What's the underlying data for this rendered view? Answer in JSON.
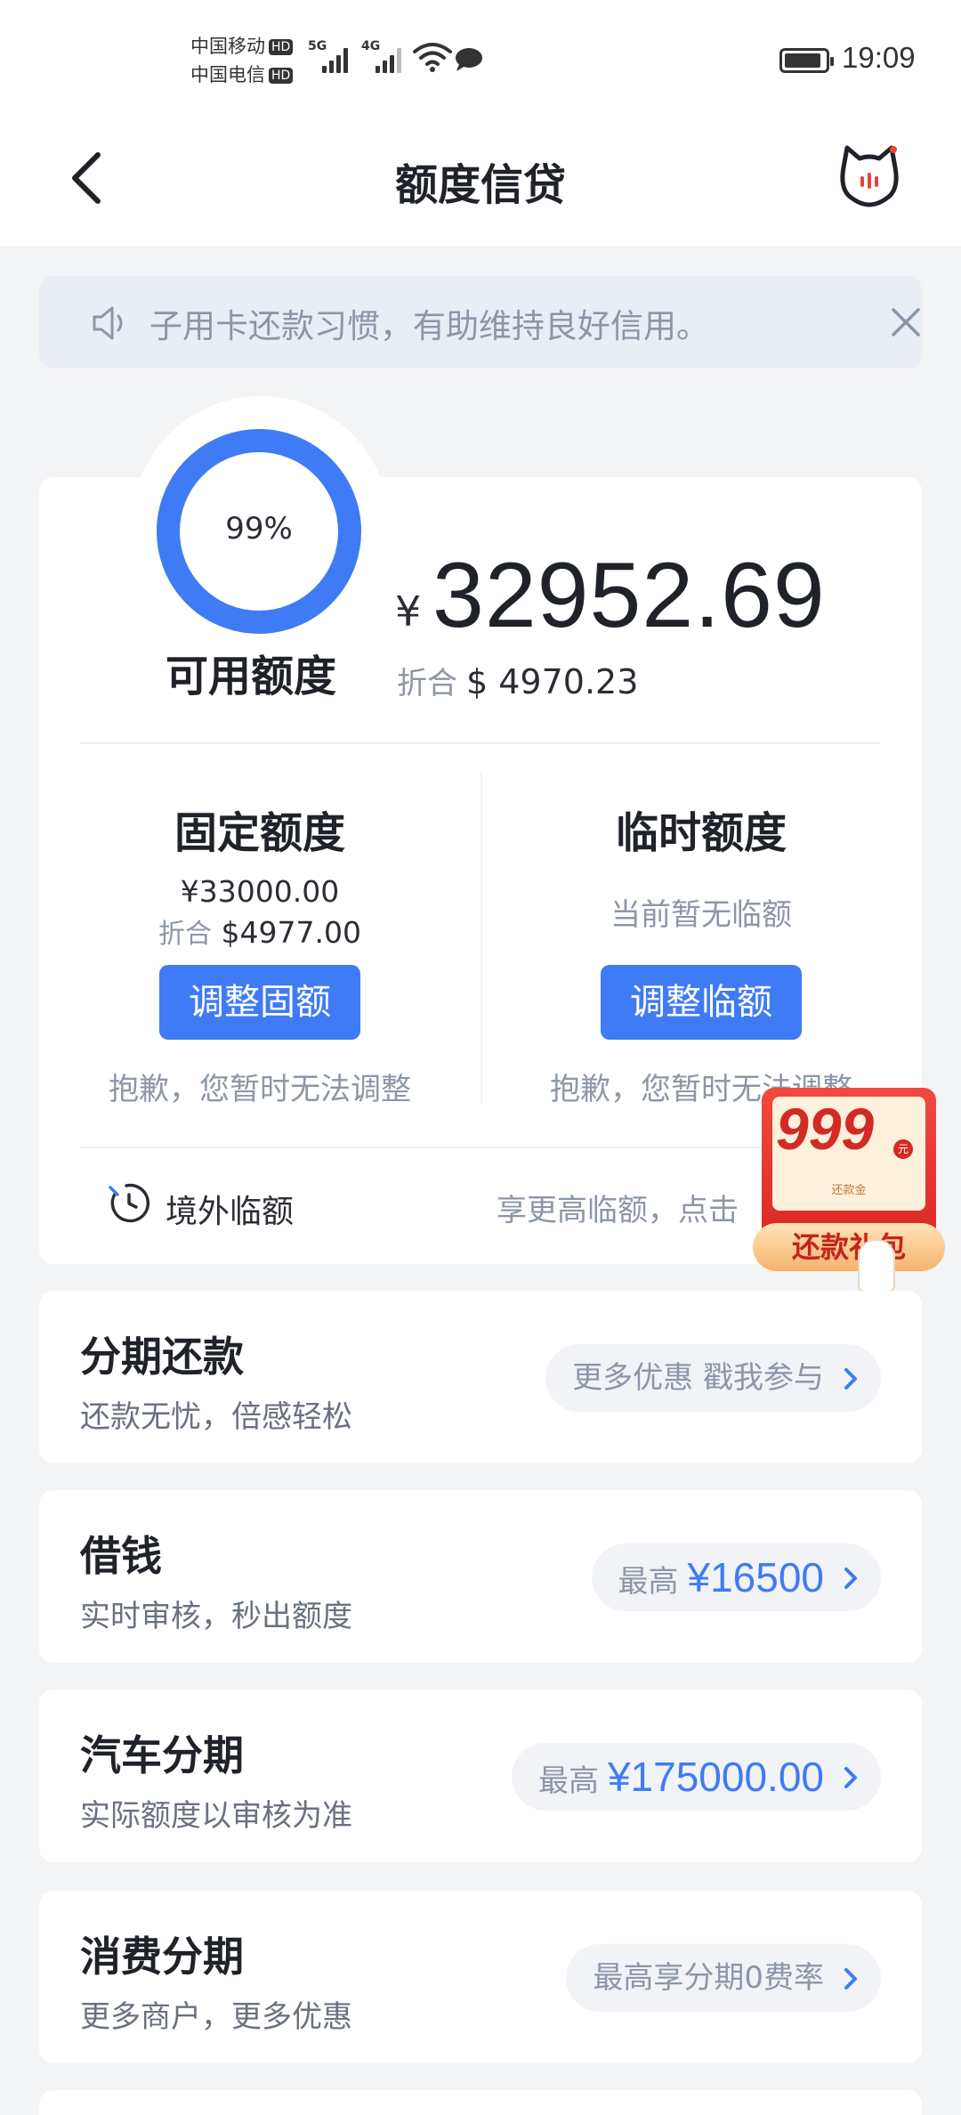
{
  "status_bar": {
    "carrier_1": "中国移动",
    "carrier_2": "中国电信",
    "hd_badge": "HD",
    "signal_1_tag": "5G",
    "signal_2_tag": "4G",
    "time": "19:09"
  },
  "header": {
    "title": "额度信贷",
    "back_icon": "chevron-left-icon",
    "service_icon": "cat-service-icon"
  },
  "notice": {
    "text": "子用卡还款习惯，有助维持良好信用。"
  },
  "available": {
    "percent": "99%",
    "percent_value": 0.99,
    "label": "可用额度",
    "currency_symbol": "¥",
    "amount": "32952.69",
    "conv_label": "折合",
    "conv_amount": "$ 4970.23"
  },
  "fixed": {
    "title": "固定额度",
    "amount": "¥33000.00",
    "conv_label": "折合",
    "conv_amount": "$4977.00",
    "button": "调整固额",
    "tip": "抱歉，您暂时无法调整"
  },
  "temp": {
    "title": "临时额度",
    "status": "当前暂无临额",
    "button": "调整临额",
    "tip": "抱歉，您暂时无法调整"
  },
  "overseas": {
    "label": "境外临额",
    "tip": "享更高临额，点击"
  },
  "promo": {
    "amount": "999",
    "unit": "元",
    "sub": "还款金",
    "ribbon": "还款礼包"
  },
  "services": [
    {
      "title": "分期还款",
      "subtitle": "还款无忧，倍感轻松",
      "pill_label": "更多优惠 戳我参与",
      "pill_value": ""
    },
    {
      "title": "借钱",
      "subtitle": "实时审核，秒出额度",
      "pill_label": "最高",
      "pill_value": "¥16500"
    },
    {
      "title": "汽车分期",
      "subtitle": "实际额度以审核为准",
      "pill_label": "最高",
      "pill_value": "¥175000.00"
    },
    {
      "title": "消费分期",
      "subtitle": "更多商户，更多优惠",
      "pill_label": "最高享分期0费率",
      "pill_value": ""
    }
  ],
  "colors": {
    "accent": "#3f7bf4",
    "background": "#f3f4f6",
    "muted_text": "#8d96a6"
  }
}
